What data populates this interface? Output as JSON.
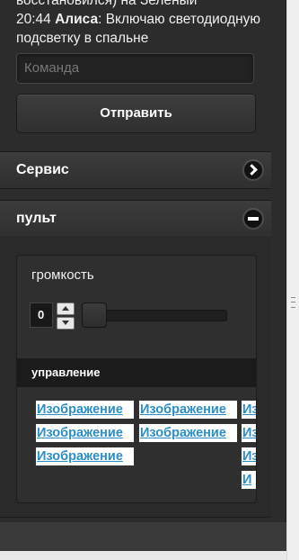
{
  "chat": {
    "line1": "восстановился) на Зеленый",
    "time": "20:44",
    "author": "Алиса",
    "message": ": Включаю светодиодную подсветку в спальне"
  },
  "command": {
    "placeholder": "Команда"
  },
  "send_label": "Отправить",
  "sections": {
    "service": {
      "title": "Сервис",
      "icon": "chevron-right-icon"
    },
    "remote": {
      "title": "пульт",
      "icon": "minus-icon"
    }
  },
  "remote": {
    "volume_label": "громкость",
    "volume_value": "0",
    "control_header": "управление",
    "image_label": "Изображение",
    "image_label_short": "Из",
    "image_label_tiny": "И"
  }
}
